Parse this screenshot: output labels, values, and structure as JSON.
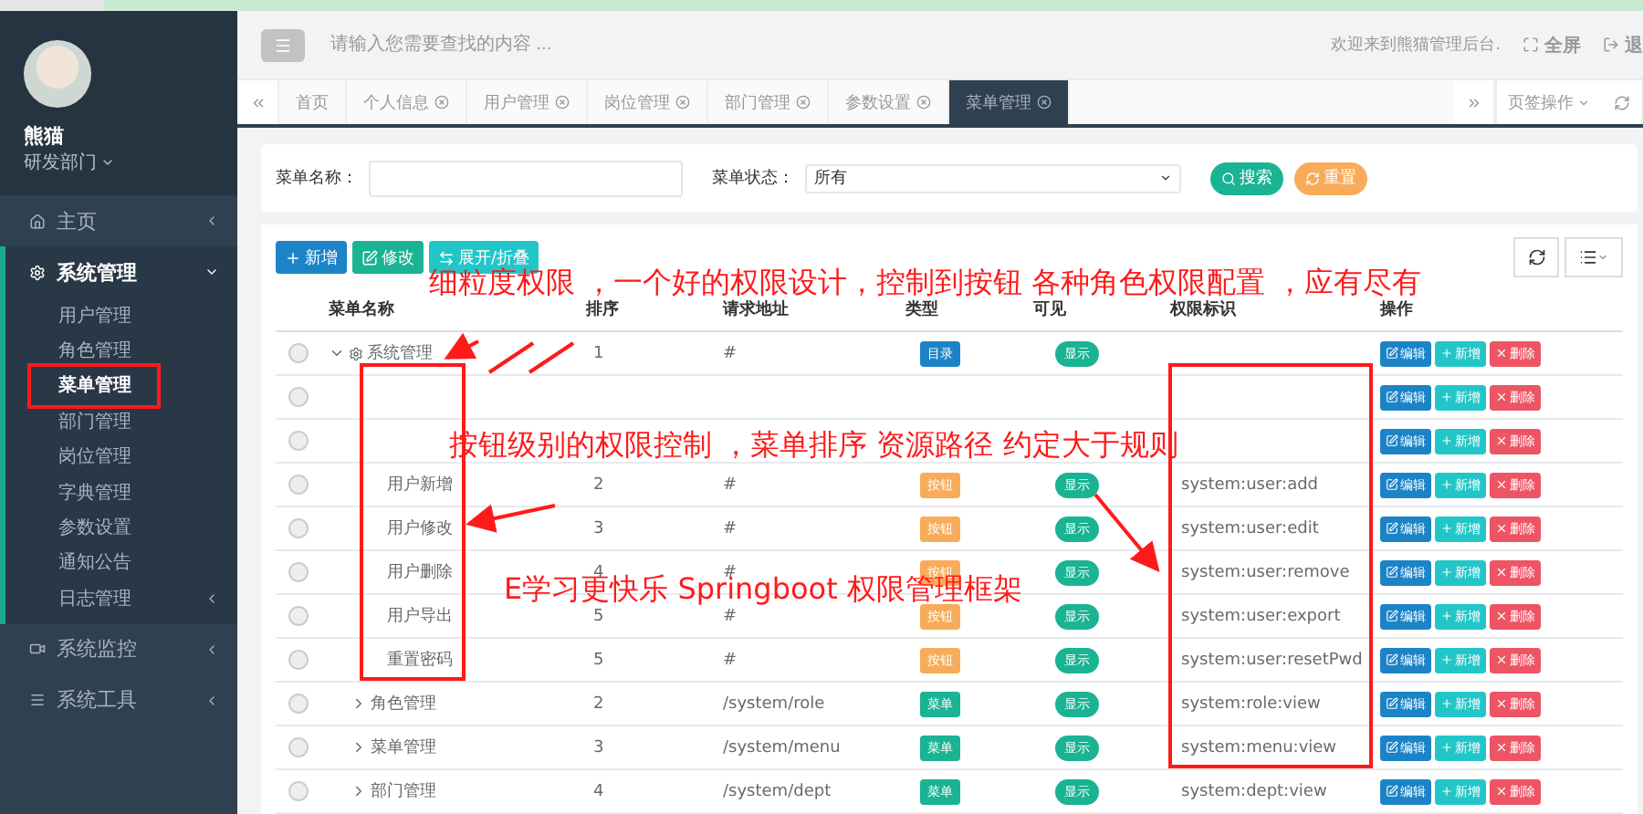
{
  "sidebar": {
    "user": {
      "name": "熊猫",
      "department": "研发部门"
    },
    "items": [
      {
        "label": "主页",
        "expanded": false,
        "has_arrow": true
      },
      {
        "label": "系统管理",
        "expanded": true,
        "has_arrow": true,
        "children": [
          {
            "label": "用户管理",
            "selected": false
          },
          {
            "label": "角色管理",
            "selected": false
          },
          {
            "label": "菜单管理",
            "selected": true
          },
          {
            "label": "部门管理",
            "selected": false
          },
          {
            "label": "岗位管理",
            "selected": false
          },
          {
            "label": "字典管理",
            "selected": false
          },
          {
            "label": "参数设置",
            "selected": false
          },
          {
            "label": "通知公告",
            "selected": false
          },
          {
            "label": "日志管理",
            "selected": false,
            "has_arrow": true
          }
        ]
      },
      {
        "label": "系统监控",
        "expanded": false,
        "has_arrow": true
      },
      {
        "label": "系统工具",
        "expanded": false,
        "has_arrow": true
      }
    ]
  },
  "header": {
    "search": {
      "placeholder": "请输入您需要查找的内容 ..."
    },
    "welcome": "欢迎来到熊猫管理后台.",
    "fullscreen": "全屏",
    "logout": "退"
  },
  "tabs": [
    {
      "label": "首页",
      "closable": false,
      "selected": false
    },
    {
      "label": "个人信息",
      "closable": true,
      "selected": false
    },
    {
      "label": "用户管理",
      "closable": true,
      "selected": false
    },
    {
      "label": "岗位管理",
      "closable": true,
      "selected": false
    },
    {
      "label": "部门管理",
      "closable": true,
      "selected": false
    },
    {
      "label": "参数设置",
      "closable": true,
      "selected": false
    },
    {
      "label": "菜单管理",
      "closable": true,
      "selected": true
    }
  ],
  "tab_actions": {
    "label": "页签操作"
  },
  "filter": {
    "name_label": "菜单名称：",
    "status_label": "菜单状态：",
    "status_value": "所有",
    "search_button": "搜索",
    "reset_button": "重置"
  },
  "toolbar": {
    "buttons": [
      {
        "label": "新增",
        "kind": "add"
      },
      {
        "label": "修改",
        "kind": "edit"
      },
      {
        "label": "展开/折叠",
        "kind": "toggle"
      }
    ]
  },
  "table": {
    "columns": [
      "菜单名称",
      "排序",
      "请求地址",
      "类型",
      "可见",
      "权限标识",
      "操作"
    ],
    "rows": [
      {
        "selected": false,
        "name": "系统管理",
        "expanded": true,
        "order": "1",
        "url": "#",
        "type": {
          "label": "目录",
          "color": "#1c84c6"
        },
        "visible": "显示",
        "perms": "",
        "actions": [
          "编辑",
          "新增",
          "删除"
        ],
        "children": [
          {
            "selected": false,
            "actions": [
              "编辑",
              "新增",
              "删除"
            ],
            "children": [
              {
                "selected": false,
                "actions": [
                  "编辑",
                  "新增",
                  "删除"
                ]
              },
              {
                "selected": false,
                "name": "用户新增",
                "order": "2",
                "url": "#",
                "type": {
                  "label": "按钮",
                  "color": "#f8ac59"
                },
                "visible": "显示",
                "perms": "system:user:add",
                "actions": [
                  "编辑",
                  "新增",
                  "删除"
                ]
              },
              {
                "selected": false,
                "name": "用户修改",
                "order": "3",
                "url": "#",
                "type": {
                  "label": "按钮",
                  "color": "#f8ac59"
                },
                "visible": "显示",
                "perms": "system:user:edit",
                "actions": [
                  "编辑",
                  "新增",
                  "删除"
                ]
              },
              {
                "selected": false,
                "name": "用户删除",
                "order": "4",
                "url": "#",
                "type": {
                  "label": "按钮",
                  "color": "#f8ac59"
                },
                "visible": "显示",
                "perms": "system:user:remove",
                "actions": [
                  "编辑",
                  "新增",
                  "删除"
                ]
              },
              {
                "selected": false,
                "name": "用户导出",
                "order": "5",
                "url": "#",
                "type": {
                  "label": "按钮",
                  "color": "#f8ac59"
                },
                "visible": "显示",
                "perms": "system:user:export",
                "actions": [
                  "编辑",
                  "新增",
                  "删除"
                ]
              },
              {
                "selected": false,
                "name": "重置密码",
                "order": "5",
                "url": "#",
                "type": {
                  "label": "按钮",
                  "color": "#f8ac59"
                },
                "visible": "显示",
                "perms": "system:user:resetPwd",
                "actions": [
                  "编辑",
                  "新增",
                  "删除"
                ]
              }
            ]
          },
          {
            "selected": false,
            "name": "角色管理",
            "expanded": false,
            "order": "2",
            "url": "/system/role",
            "type": {
              "label": "菜单",
              "color": "#1ab394"
            },
            "visible": "显示",
            "perms": "system:role:view",
            "actions": [
              "编辑",
              "新增",
              "删除"
            ]
          },
          {
            "selected": false,
            "name": "菜单管理",
            "expanded": false,
            "order": "3",
            "url": "/system/menu",
            "type": {
              "label": "菜单",
              "color": "#1ab394"
            },
            "visible": "显示",
            "perms": "system:menu:view",
            "actions": [
              "编辑",
              "新增",
              "删除"
            ]
          },
          {
            "selected": false,
            "name": "部门管理",
            "expanded": false,
            "order": "4",
            "url": "/system/dept",
            "type": {
              "label": "菜单",
              "color": "#1ab394"
            },
            "visible": "显示",
            "perms": "system:dept:view",
            "actions": [
              "编辑",
              "新增",
              "删除"
            ]
          }
        ]
      }
    ]
  },
  "annotations": [
    "细粒度权限 ，一个好的权限设计，控制到按钮 各种角色权限配置 ，应有尽有",
    "按钮级别的权限控制 ，菜单排序 资源路径 约定大于规则",
    "E学习更快乐 Springboot 权限管理框架"
  ]
}
